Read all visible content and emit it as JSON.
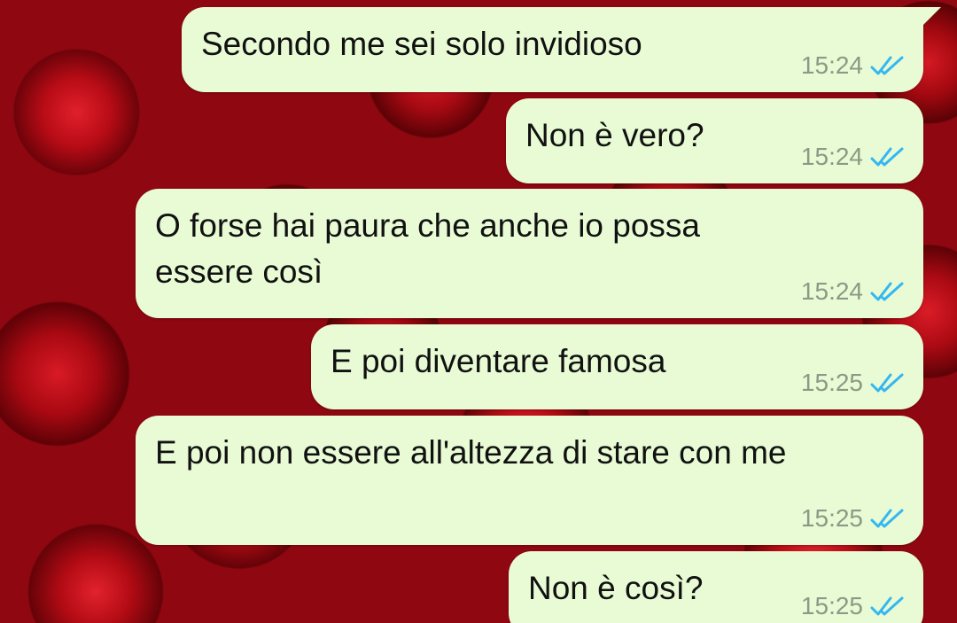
{
  "conversation": {
    "messages": [
      {
        "text": "Secondo me sei solo invidioso",
        "time": "15:24",
        "status_icon": "double-check-read-icon"
      },
      {
        "text": "Non è vero?",
        "time": "15:24",
        "status_icon": "double-check-read-icon"
      },
      {
        "text": "O forse hai paura che anche io possa\nessere così",
        "time": "15:24",
        "status_icon": "double-check-read-icon"
      },
      {
        "text": "E poi diventare famosa",
        "time": "15:25",
        "status_icon": "double-check-read-icon"
      },
      {
        "text": "E poi non essere all'altezza di stare con me",
        "time": "15:25",
        "status_icon": "double-check-read-icon"
      },
      {
        "text": "Non è così?",
        "time": "15:25",
        "status_icon": "double-check-read-icon"
      }
    ]
  },
  "colors": {
    "bubble_background": "#e8fbd5",
    "read_ticks": "#34b7f1",
    "timestamp": "#8a9a86",
    "wallpaper": "#8f0710"
  },
  "wallpaper": "red-roses"
}
